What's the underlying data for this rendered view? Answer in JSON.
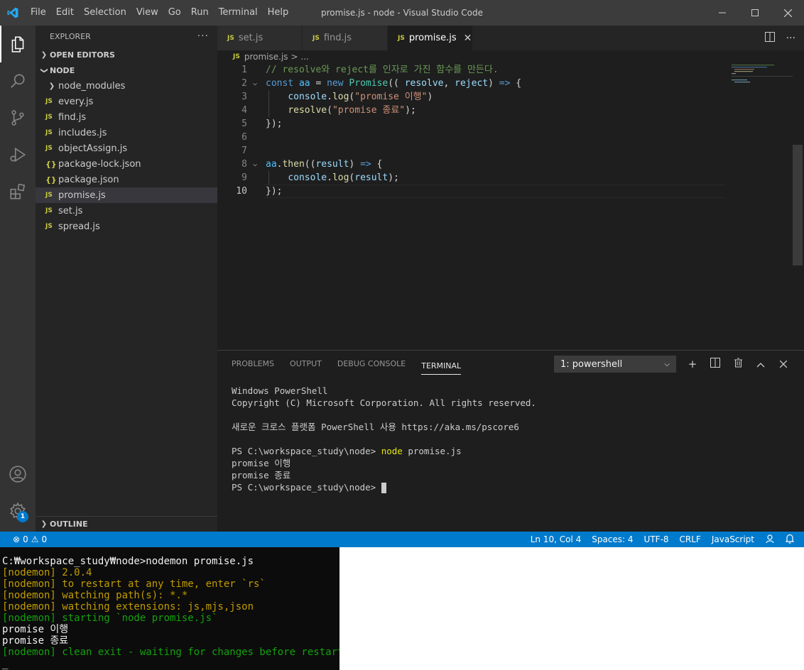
{
  "window": {
    "title": "promise.js - node - Visual Studio Code",
    "menu": [
      "File",
      "Edit",
      "Selection",
      "View",
      "Go",
      "Run",
      "Terminal",
      "Help"
    ]
  },
  "sidebar": {
    "header": "EXPLORER",
    "more": "···",
    "open_editors": "OPEN EDITORS",
    "folder": "NODE",
    "items": [
      {
        "label": "node_modules",
        "kind": "folder"
      },
      {
        "label": "every.js",
        "kind": "js"
      },
      {
        "label": "find.js",
        "kind": "js"
      },
      {
        "label": "includes.js",
        "kind": "js"
      },
      {
        "label": "objectAssign.js",
        "kind": "js"
      },
      {
        "label": "package-lock.json",
        "kind": "json"
      },
      {
        "label": "package.json",
        "kind": "json"
      },
      {
        "label": "promise.js",
        "kind": "js",
        "selected": true
      },
      {
        "label": "set.js",
        "kind": "js"
      },
      {
        "label": "spread.js",
        "kind": "js"
      }
    ],
    "outline": "OUTLINE",
    "js_badge": "JS",
    "json_badge": "{}"
  },
  "tabs": [
    {
      "label": "set.js"
    },
    {
      "label": "find.js"
    },
    {
      "label": "promise.js",
      "active": true
    }
  ],
  "breadcrumb": {
    "file": "promise.js",
    "rest": "> ..."
  },
  "code": {
    "line_numbers": [
      "1",
      "2",
      "3",
      "4",
      "5",
      "6",
      "7",
      "8",
      "9",
      "10"
    ],
    "lines": [
      [
        [
          "t-com",
          "// resolve와 reject를 인자로 가진 함수를 만든다."
        ]
      ],
      [
        [
          "t-kw",
          "const "
        ],
        [
          "t-var",
          "aa"
        ],
        [
          "t-pl",
          " = "
        ],
        [
          "t-kw",
          "new "
        ],
        [
          "t-cls",
          "Promise"
        ],
        [
          "t-pl",
          "(( "
        ],
        [
          "t-par",
          "resolve"
        ],
        [
          "t-pl",
          ", "
        ],
        [
          "t-par",
          "reject"
        ],
        [
          "t-pl",
          ") "
        ],
        [
          "t-kw",
          "=>"
        ],
        [
          "t-pl",
          " {"
        ]
      ],
      [
        [
          "t-pl",
          "    "
        ],
        [
          "t-par",
          "console"
        ],
        [
          "t-pl",
          "."
        ],
        [
          "t-fn",
          "log"
        ],
        [
          "t-pl",
          "("
        ],
        [
          "t-str",
          "\"promise 이행\""
        ],
        [
          "t-pl",
          ")"
        ]
      ],
      [
        [
          "t-pl",
          "    "
        ],
        [
          "t-fn",
          "resolve"
        ],
        [
          "t-pl",
          "("
        ],
        [
          "t-str",
          "\"promise 종료\""
        ],
        [
          "t-pl",
          ");"
        ]
      ],
      [
        [
          "t-pl",
          "});"
        ]
      ],
      [],
      [],
      [
        [
          "t-var",
          "aa"
        ],
        [
          "t-pl",
          "."
        ],
        [
          "t-fn",
          "then"
        ],
        [
          "t-pl",
          "(("
        ],
        [
          "t-par",
          "result"
        ],
        [
          "t-pl",
          ") "
        ],
        [
          "t-kw",
          "=>"
        ],
        [
          "t-pl",
          " {"
        ]
      ],
      [
        [
          "t-pl",
          "    "
        ],
        [
          "t-par",
          "console"
        ],
        [
          "t-pl",
          "."
        ],
        [
          "t-fn",
          "log"
        ],
        [
          "t-pl",
          "("
        ],
        [
          "t-par",
          "result"
        ],
        [
          "t-pl",
          ");"
        ]
      ],
      [
        [
          "t-pl",
          "});"
        ]
      ]
    ]
  },
  "panel": {
    "tabs": [
      "PROBLEMS",
      "OUTPUT",
      "DEBUG CONSOLE",
      "TERMINAL"
    ],
    "active_tab": "TERMINAL",
    "terminal_select": "1: powershell",
    "terminal_lines": [
      "Windows PowerShell",
      "Copyright (C) Microsoft Corporation. All rights reserved.",
      "",
      "새로운 크로스 플랫폼 PowerShell 사용 https://aka.ms/pscore6",
      "",
      "PS C:\\workspace_study\\node> ",
      "promise 이행",
      "promise 종료",
      "PS C:\\workspace_study\\node> "
    ],
    "command_word": "node",
    "command_args": " promise.js"
  },
  "statusbar": {
    "errors": "0",
    "warnings": "0",
    "position": "Ln 10, Col 4",
    "spaces": "Spaces: 4",
    "encoding": "UTF-8",
    "eol": "CRLF",
    "language": "JavaScript"
  },
  "settings_badge": "1",
  "cmd": {
    "lines": [
      {
        "text": "C:₩workspace_study₩node>nodemon promise.js",
        "color": "c-white"
      },
      {
        "text": "[nodemon] 2.0.4",
        "color": "c-yel"
      },
      {
        "text": "[nodemon] to restart at any time, enter `rs`",
        "color": "c-yel"
      },
      {
        "text": "[nodemon] watching path(s): *.*",
        "color": "c-yel"
      },
      {
        "text": "[nodemon] watching extensions: js,mjs,json",
        "color": "c-yel"
      },
      {
        "text": "[nodemon] starting `node promise.js`",
        "color": "c-grn"
      },
      {
        "text": "promise 이행",
        "color": "c-white"
      },
      {
        "text": "promise 종료",
        "color": "c-white"
      },
      {
        "text": "[nodemon] clean exit - waiting for changes before restart",
        "color": "c-grn"
      },
      {
        "text": "_",
        "color": "c-white"
      }
    ]
  },
  "colors": {
    "accent": "#007acc",
    "titlebar": "#3c3c3c",
    "editor_bg": "#1e1e1e"
  }
}
